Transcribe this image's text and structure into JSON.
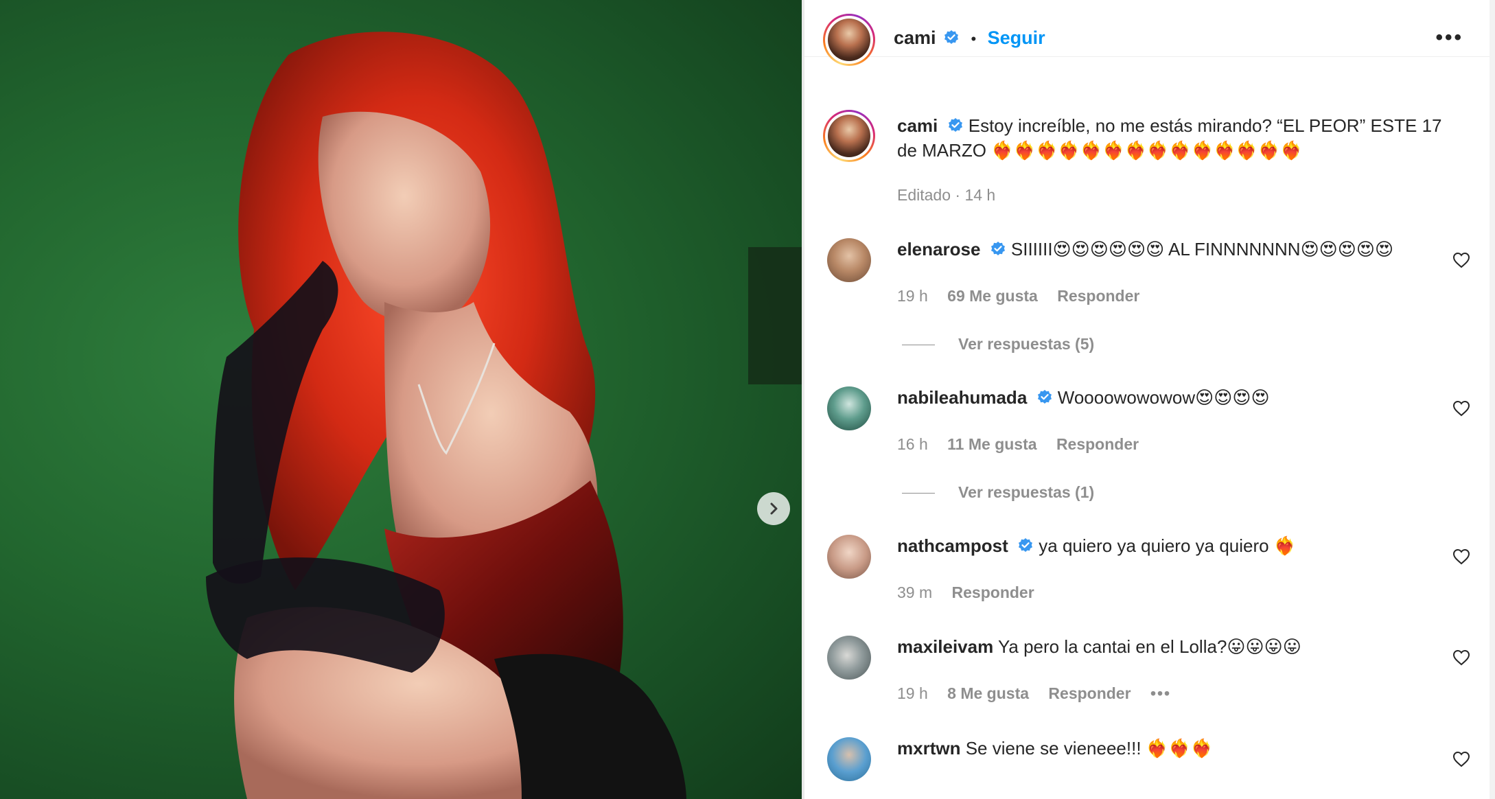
{
  "post": {
    "author": "cami",
    "verified": true,
    "follow_label": "Seguir",
    "separator": "•",
    "more_label": "•••",
    "next_label": "›",
    "caption_text": "Estoy increíble, no me estás mirando? “EL PEOR” ESTE 17 de MARZO ❤️‍🔥❤️‍🔥❤️‍🔥❤️‍🔥❤️‍🔥❤️‍🔥❤️‍🔥❤️‍🔥❤️‍🔥❤️‍🔥❤️‍🔥❤️‍🔥❤️‍🔥❤️‍🔥",
    "caption_meta": "Editado · 14 h"
  },
  "comments": [
    {
      "user": "elenarose",
      "verified": true,
      "text": "SIIIIII😍😍😍😍😍😍 AL FINNNNNNN😍😍😍😍😍",
      "time": "19 h",
      "likes": "69 Me gusta",
      "reply": "Responder",
      "view_replies": "Ver respuestas (5)"
    },
    {
      "user": "nabileahumada",
      "verified": true,
      "text": "Woooowowowow😍😍😍😍",
      "time": "16 h",
      "likes": "11 Me gusta",
      "reply": "Responder",
      "view_replies": "Ver respuestas (1)"
    },
    {
      "user": "nathcampost",
      "verified": true,
      "text": "ya quiero ya quiero ya quiero ❤️‍🔥",
      "time": "39 m",
      "reply": "Responder"
    },
    {
      "user": "maxileivam",
      "verified": false,
      "text": "Ya pero la cantai en el Lolla?😛😛😛😛",
      "time": "19 h",
      "likes": "8 Me gusta",
      "reply": "Responder",
      "more": "•••"
    },
    {
      "user": "mxrtwn",
      "verified": false,
      "text": "Se viene se vieneee!!! ❤️‍🔥❤️‍🔥❤️‍🔥"
    }
  ],
  "colors": {
    "accent": "#0095f6",
    "verified": "#3897f0",
    "secondary_text": "#8e8e8e"
  }
}
